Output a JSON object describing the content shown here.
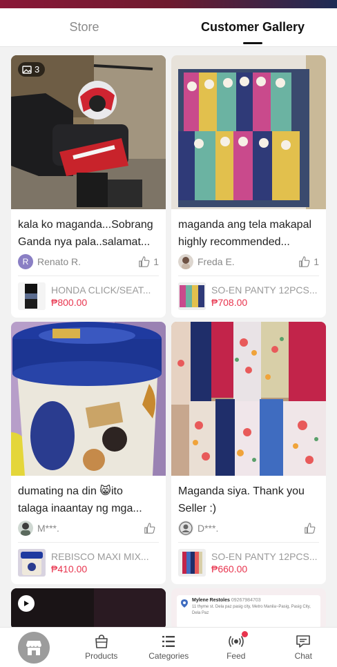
{
  "tabs": [
    {
      "label": "Store",
      "active": false
    },
    {
      "label": "Customer Gallery",
      "active": true
    }
  ],
  "cards": [
    {
      "photo_count": "3",
      "review_lines": [
        "kala ko maganda...Sobrang",
        "Ganda nya pala..salamat..."
      ],
      "user": "Renato R.",
      "avatar_letter": "R",
      "likes": "1",
      "product_name": "HONDA CLICK/SEAT...",
      "price": "₱800.00"
    },
    {
      "review_lines": [
        "maganda ang tela makapal",
        "highly recommended..."
      ],
      "user": "Freda E.",
      "likes": "1",
      "product_name": "SO-EN PANTY 12PCS...",
      "price": "₱708.00"
    },
    {
      "review_lines": [
        "dumating na din 😸ito",
        "talaga inaantay ng mga..."
      ],
      "user": "M***.",
      "likes": "",
      "product_name": "REBISCO MAXI MIX...",
      "price": "₱410.00"
    },
    {
      "review_lines": [
        "Maganda siya. Thank you",
        "Seller :)"
      ],
      "user": "D***.",
      "likes": "",
      "product_name": "SO-EN PANTY 12PCS...",
      "price": "₱660.00"
    }
  ],
  "partial_card": {
    "name": "Mylene Restoles",
    "phone": "09267984703",
    "address": "11 thyme st. Dela paz pasig city, Metro Manila~Pasig, Pasig City, Dela Paz"
  },
  "nav": {
    "products": "Products",
    "categories": "Categories",
    "feed": "Feed",
    "chat": "Chat"
  },
  "colors": {
    "price": "#e8344e",
    "accent_dot": "#e8344e",
    "avatar_renato": "#8a7fc4"
  }
}
